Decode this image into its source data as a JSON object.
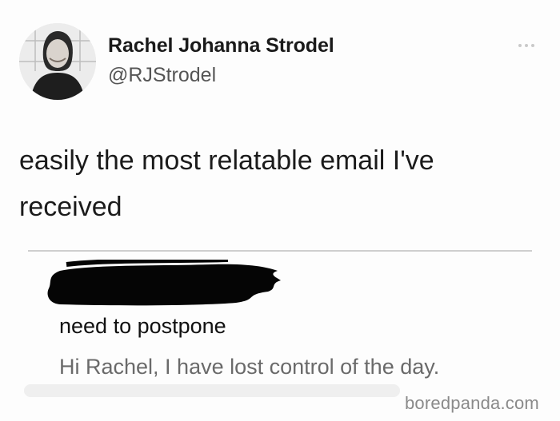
{
  "tweet": {
    "author": {
      "display_name": "Rachel Johanna Strodel",
      "handle": "@RJStrodel",
      "avatar_icon": "profile-photo"
    },
    "text": "easily the most relatable email I've received",
    "more_icon": "ellipsis-icon"
  },
  "email": {
    "sender_redacted": true,
    "subject": "need to postpone",
    "preview": "Hi Rachel, I have lost control of the day."
  },
  "watermark": "boredpanda.com"
}
